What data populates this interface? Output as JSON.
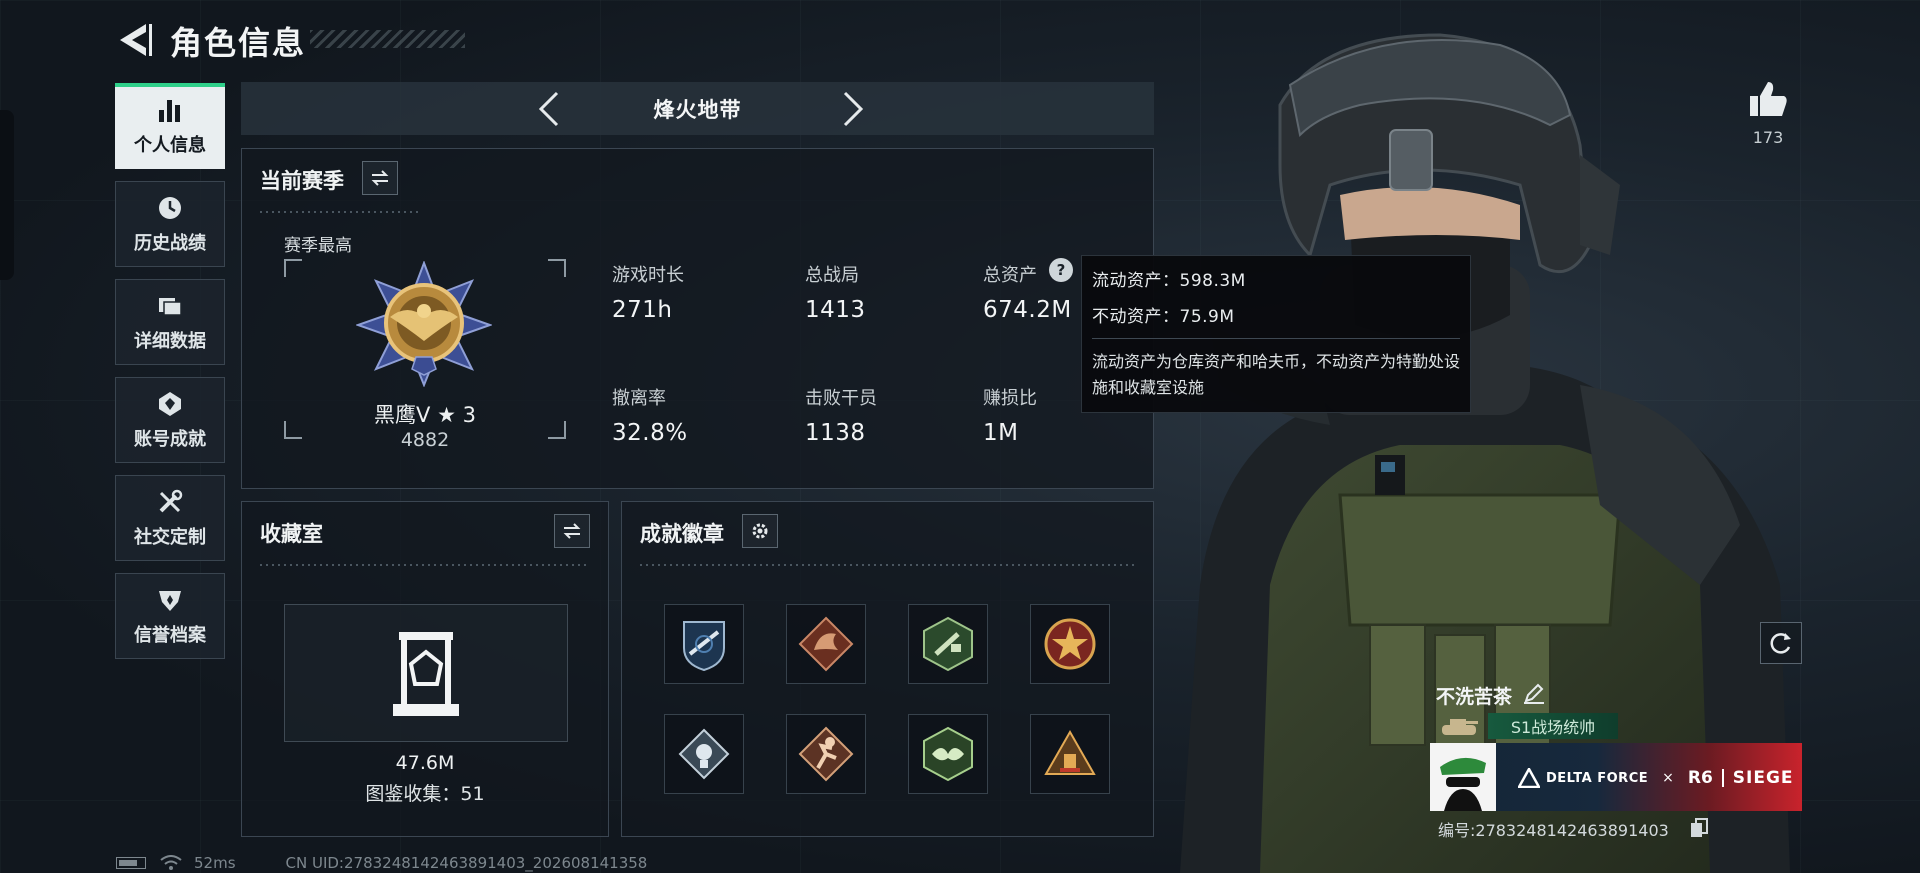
{
  "header": {
    "title": "角色信息"
  },
  "sidebar": {
    "items": [
      {
        "label": "个人信息",
        "icon": "bar-chart-icon",
        "active": true
      },
      {
        "label": "历史战绩",
        "icon": "history-clock-icon",
        "active": false
      },
      {
        "label": "详细数据",
        "icon": "folder-icon",
        "active": false
      },
      {
        "label": "账号成就",
        "icon": "achievement-icon",
        "active": false
      },
      {
        "label": "社交定制",
        "icon": "wrench-screwdriver-icon",
        "active": false
      },
      {
        "label": "信誉档案",
        "icon": "reputation-icon",
        "active": false
      }
    ]
  },
  "mode": {
    "label": "烽火地带"
  },
  "season": {
    "title": "当前赛季",
    "sub_label": "赛季最高",
    "rank_name": "黑鹰V ★ 3",
    "rank_score": "4882",
    "stats": [
      {
        "label": "游戏时长",
        "value": "271h"
      },
      {
        "label": "总战局",
        "value": "1413"
      },
      {
        "label": "总资产",
        "value": "674.2M"
      },
      {
        "label": "撤离率",
        "value": "32.8%"
      },
      {
        "label": "击败干员",
        "value": "1138"
      },
      {
        "label": "赚损比",
        "value": "1M"
      }
    ],
    "help_symbol": "?"
  },
  "tooltip": {
    "liquid": "流动资产：598.3M",
    "fixed": "不动资产：75.9M",
    "description": "流动资产为仓库资产和哈夫币，不动资产为特勤处设施和收藏室设施"
  },
  "collection": {
    "title": "收藏室",
    "value": "47.6M",
    "count": "图鉴收集：51"
  },
  "achievements": {
    "title": "成就徽章",
    "badges": [
      {
        "icon": "shield-rifle-badge-icon",
        "color": "#4f7fb0"
      },
      {
        "icon": "dragon-badge-icon",
        "color": "#b8613e"
      },
      {
        "icon": "hexagon-tool-badge-icon",
        "color": "#6f9a5a"
      },
      {
        "icon": "star-crest-badge-icon",
        "color": "#b3372f"
      },
      {
        "icon": "diamond-emblem-badge-icon",
        "color": "#8fa6b6"
      },
      {
        "icon": "runner-badge-icon",
        "color": "#b7704a"
      },
      {
        "icon": "wing-hexagon-badge-icon",
        "color": "#7da95b"
      },
      {
        "icon": "pyramid-badge-icon",
        "color": "#c08a3a"
      }
    ]
  },
  "profile": {
    "likes": "173",
    "player_name": "不洗苦茶",
    "player_title": "S1战场统帅",
    "banner_brand_1": "DELTA FORCE",
    "banner_sep": "×",
    "banner_brand_2a": "R6",
    "banner_brand_2b": "SIEGE",
    "player_id": "编号:2783248142463891403"
  },
  "status": {
    "ping": "52ms",
    "uid": "CN UID:2783248142463891403_202608141358"
  },
  "colors": {
    "accent": "#2fd08a",
    "panel_border": "#3b4652",
    "title_green": "#175a3e",
    "banner_red": "#c9232c"
  }
}
